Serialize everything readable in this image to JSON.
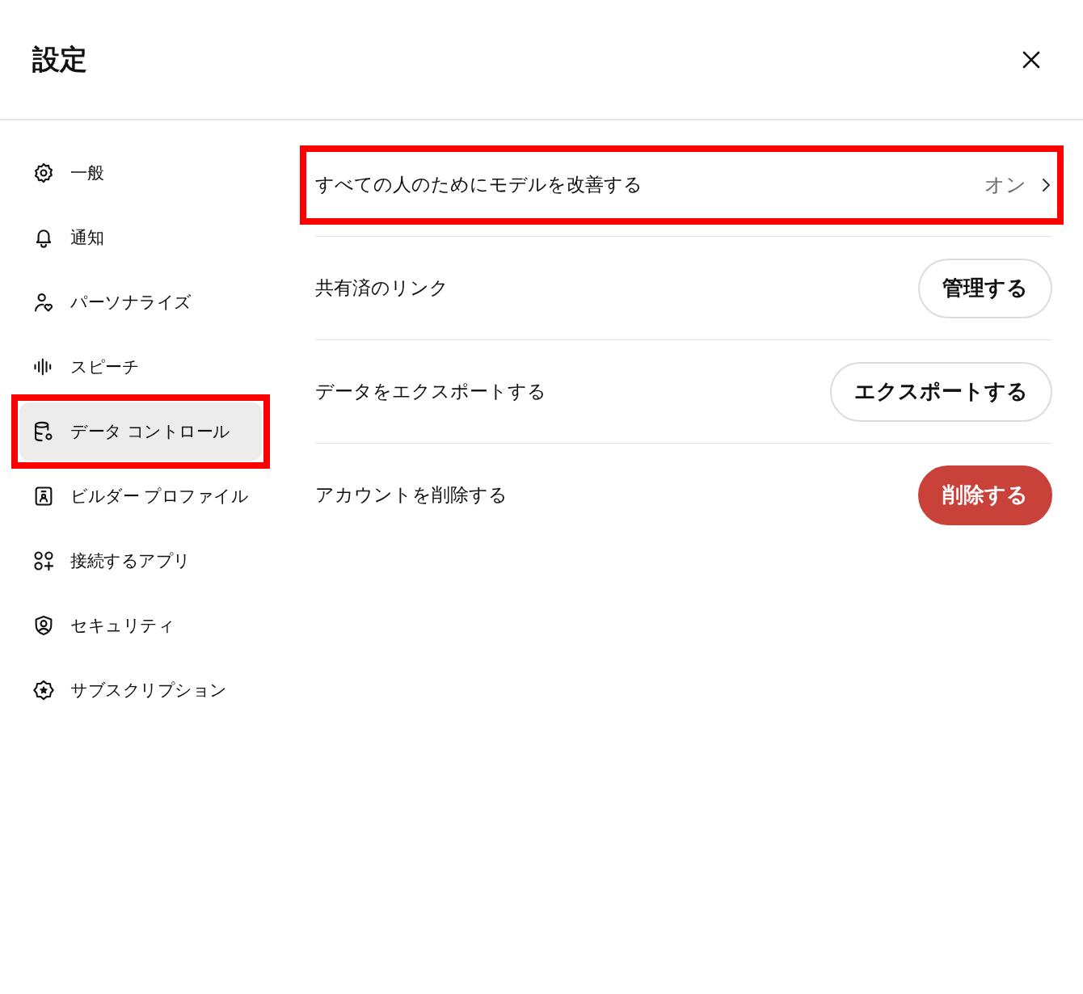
{
  "header": {
    "title": "設定"
  },
  "sidebar": {
    "items": [
      {
        "label": "一般",
        "selected": false,
        "highlighted": false
      },
      {
        "label": "通知",
        "selected": false,
        "highlighted": false
      },
      {
        "label": "パーソナライズ",
        "selected": false,
        "highlighted": false
      },
      {
        "label": "スピーチ",
        "selected": false,
        "highlighted": false
      },
      {
        "label": "データ コントロール",
        "selected": true,
        "highlighted": true
      },
      {
        "label": "ビルダー プロファイル",
        "selected": false,
        "highlighted": false
      },
      {
        "label": "接続するアプリ",
        "selected": false,
        "highlighted": false
      },
      {
        "label": "セキュリティ",
        "selected": false,
        "highlighted": false
      },
      {
        "label": "サブスクリプション",
        "selected": false,
        "highlighted": false
      }
    ]
  },
  "rows": [
    {
      "kind": "link",
      "label": "すべての人のためにモデルを改善する",
      "value": "オン",
      "highlighted": true
    },
    {
      "kind": "button",
      "label": "共有済のリンク",
      "button": "管理する",
      "highlighted": false
    },
    {
      "kind": "button",
      "label": "データをエクスポートする",
      "button": "エクスポートする",
      "highlighted": false
    },
    {
      "kind": "danger",
      "label": "アカウントを削除する",
      "button": "削除する",
      "highlighted": false
    }
  ]
}
